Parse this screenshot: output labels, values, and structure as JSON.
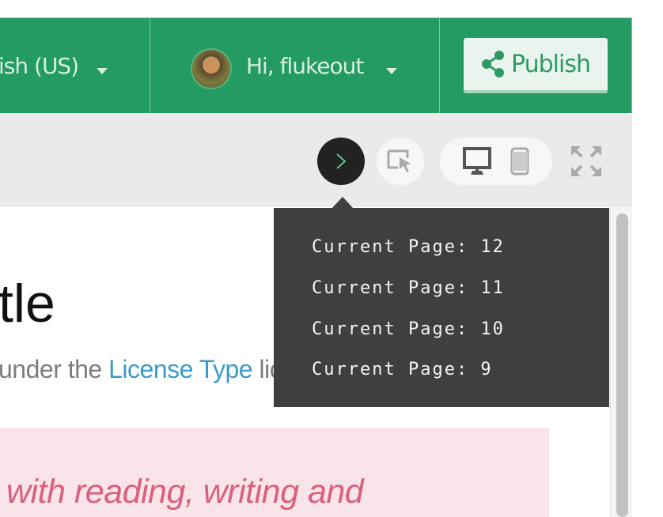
{
  "header": {
    "language_label": "ish (US)",
    "greeting": "Hi, flukeout",
    "publish_label": "Publish",
    "brand_color": "#239b62"
  },
  "toolbar": {
    "console_icon": "chevron-right-icon",
    "inspect_icon": "cursor-select-icon",
    "desktop_icon": "desktop-icon",
    "mobile_icon": "mobile-icon",
    "fullscreen_icon": "expand-icon"
  },
  "console": {
    "lines": [
      "Current Page: 12",
      "Current Page: 11",
      "Current Page: 10",
      "Current Page: 9"
    ]
  },
  "content": {
    "title": "tle",
    "subtitle_prefix": "under the ",
    "license_link": "License Type",
    "subtitle_suffix": " licence.",
    "callout": "with reading, writing and"
  }
}
